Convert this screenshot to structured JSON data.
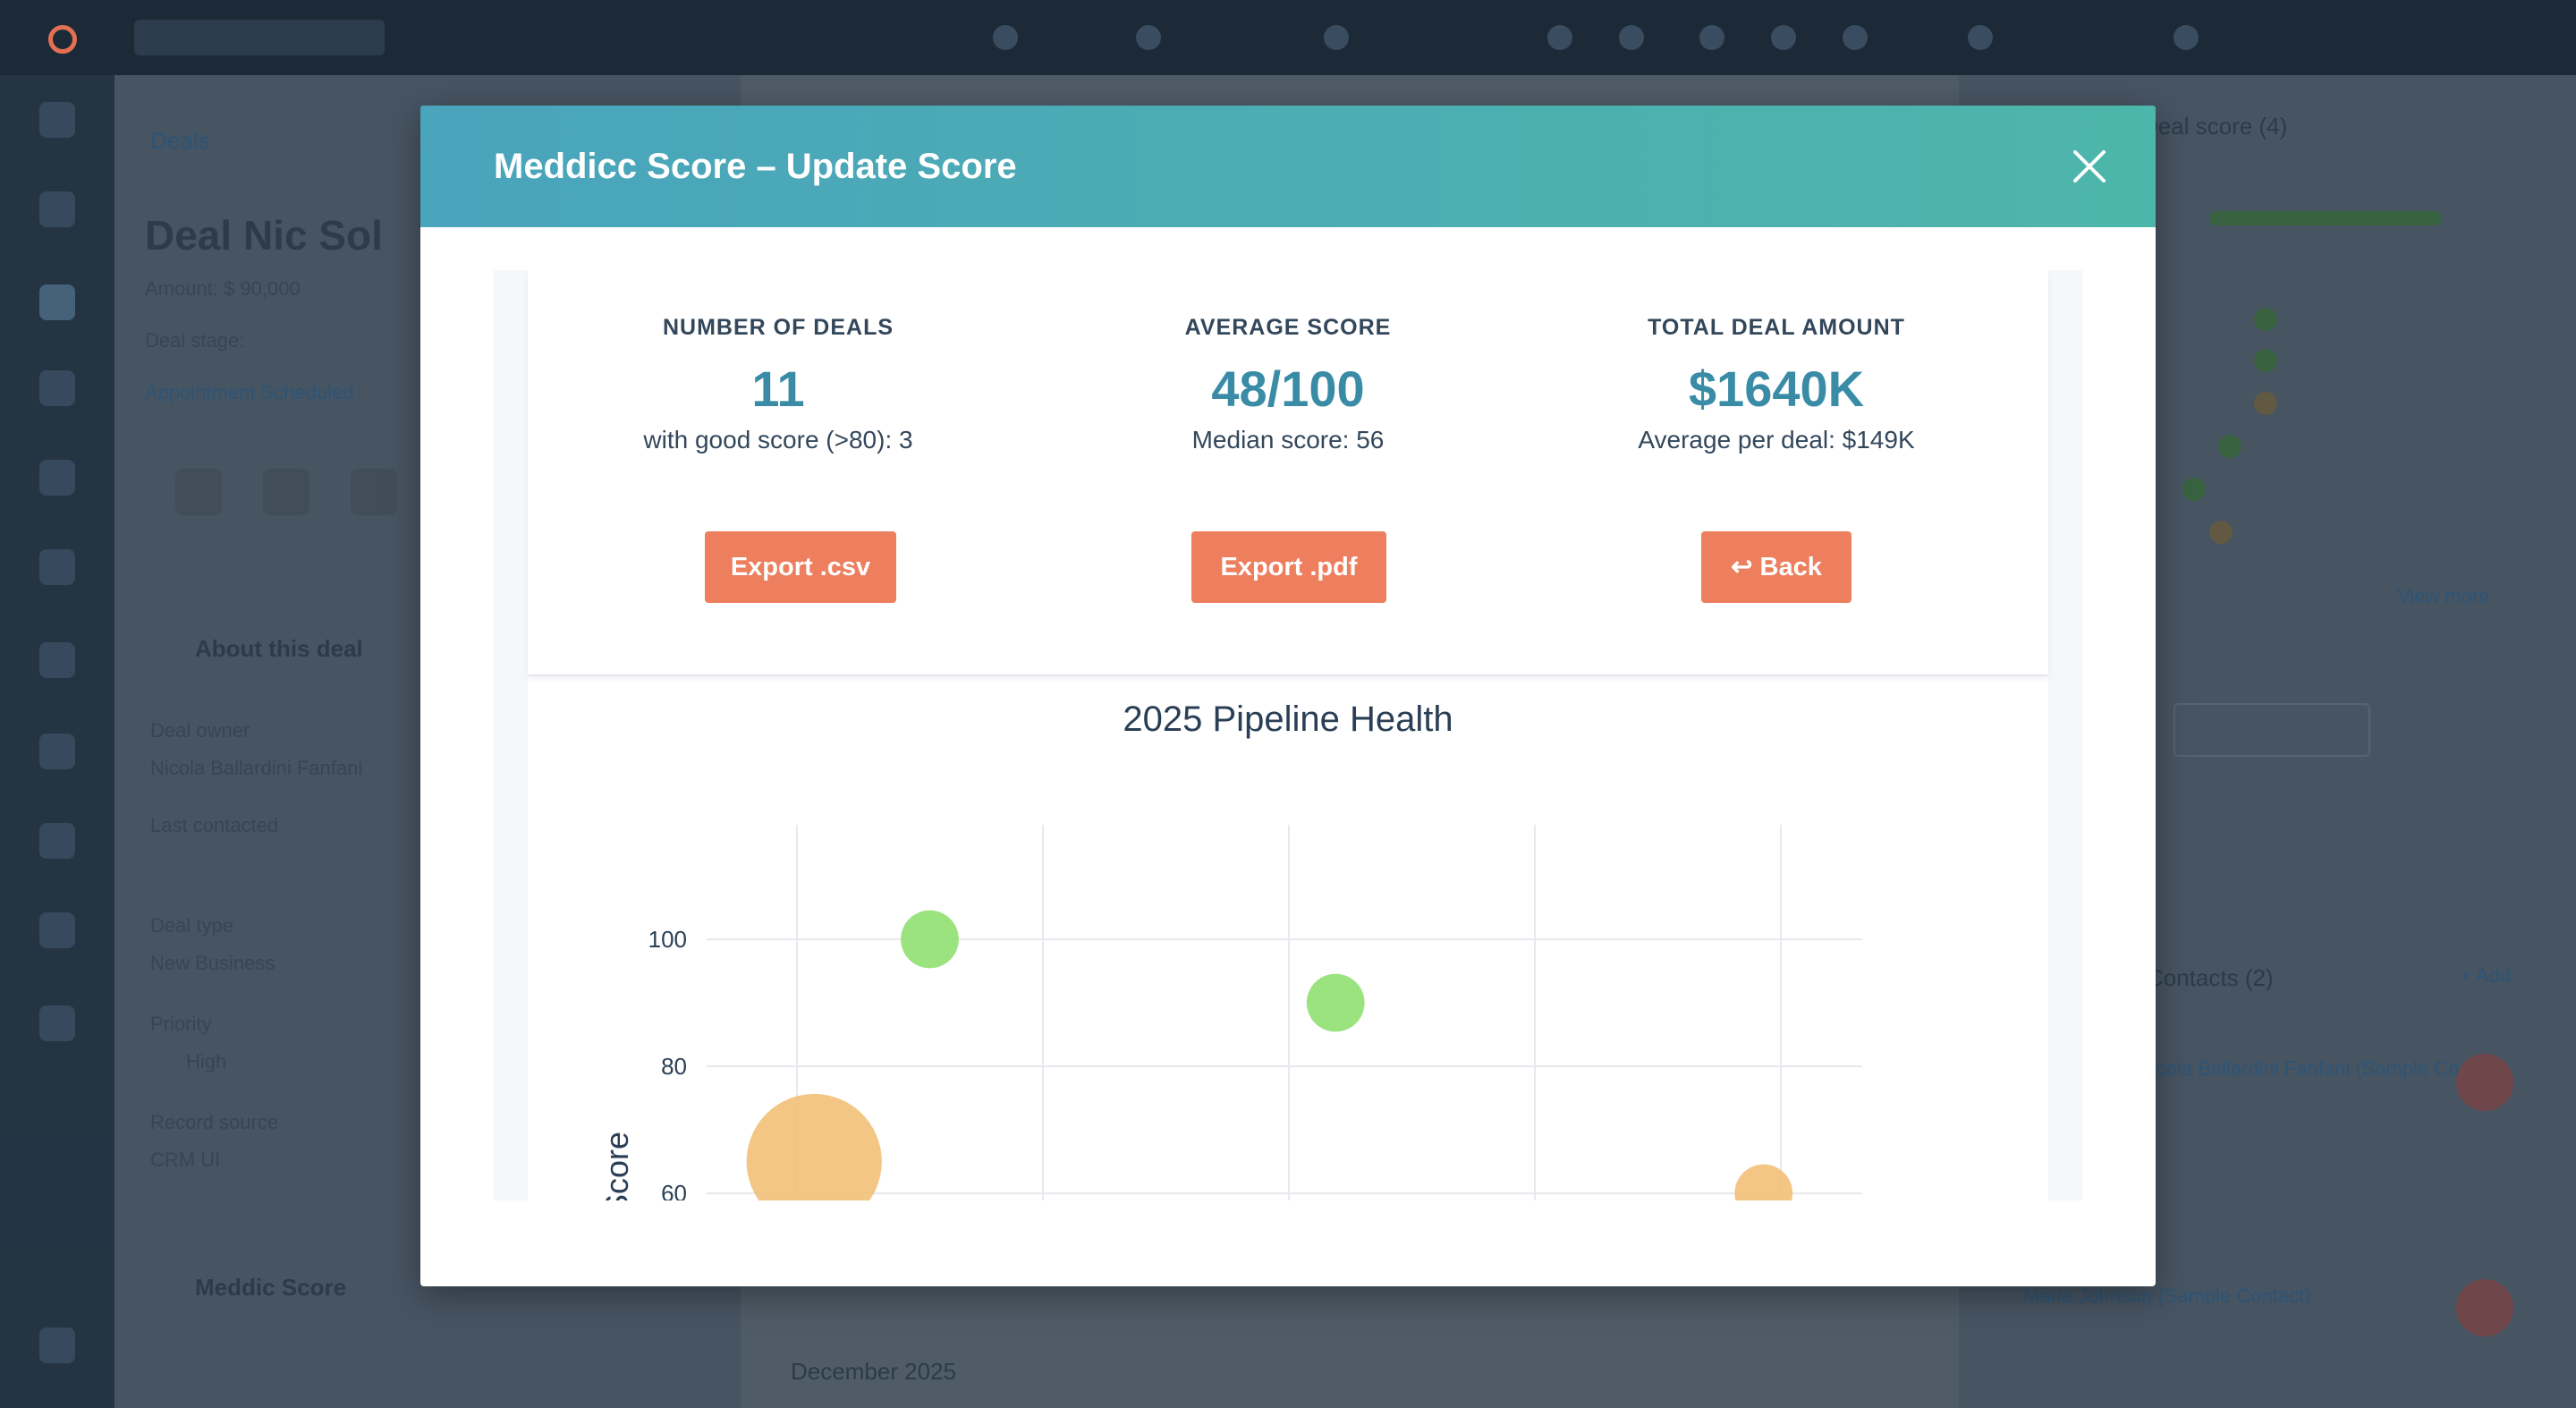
{
  "background_app": {
    "breadcrumb": "Deals",
    "deal_title": "Deal Nic Sol",
    "amount_line": "Amount: $ 90,000",
    "deal_stage": "Deal stage:",
    "stage_label": "Stage:",
    "stage_value": "Appointment Scheduled",
    "about_section": "About this deal",
    "deal_owner_label": "Deal owner",
    "deal_owner_value": "Nicola Ballardini Fanfani",
    "last_contacted_label": "Last contacted",
    "deal_type_label": "Deal type",
    "deal_type_value": "New Business",
    "priority_label": "Priority",
    "priority_value": "High",
    "record_source_label": "Record source",
    "record_source_value": "CRM UI",
    "meddic_section": "Meddic Score",
    "activity_date": "December 2025",
    "right_panel_title": "Deal score (4)",
    "more_label": "View more",
    "contacts_title": "Contacts (2)",
    "add_label": "+ Add",
    "contact_1": "Nicola Ballardini Fanfani (Sample Contact)",
    "contact_2": "Maria Johnson (Sample Contact)"
  },
  "modal": {
    "title": "Meddicc Score – Update Score",
    "close_icon": "close-icon",
    "stats": [
      {
        "label": "NUMBER OF DEALS",
        "value": "11",
        "sub": "with good score (>80): 3"
      },
      {
        "label": "AVERAGE SCORE",
        "value": "48/100",
        "sub": "Median score: 56"
      },
      {
        "label": "TOTAL DEAL AMOUNT",
        "value": "$1640K",
        "sub": "Average per deal: $149K"
      }
    ],
    "buttons": {
      "export_csv": "Export .csv",
      "export_pdf": "Export .pdf",
      "back": "↩ Back",
      "back_icon": "return-arrow-icon"
    },
    "colors": {
      "header_gradient_start": "#4aa4bc",
      "header_gradient_end": "#4db6aa",
      "accent_value": "#3a8ca6",
      "button": "#ed7e5e",
      "good_point": "#90e070",
      "medium_point": "#f2c078"
    }
  },
  "chart_data": {
    "type": "scatter",
    "title": "2025 Pipeline Health",
    "ylabel": "Score",
    "y_ticks": [
      60,
      80,
      100
    ],
    "ylim": [
      60,
      119
    ],
    "x_gridlines": 5,
    "grid": true,
    "points": [
      {
        "x_index": 0.54,
        "y": 100,
        "size": 24,
        "status": "good"
      },
      {
        "x_index": 2.19,
        "y": 90,
        "size": 24,
        "status": "good"
      },
      {
        "x_index": 0.07,
        "y": 65,
        "size": 56,
        "status": "medium"
      },
      {
        "x_index": 3.93,
        "y": 60,
        "size": 24,
        "status": "medium"
      }
    ]
  }
}
